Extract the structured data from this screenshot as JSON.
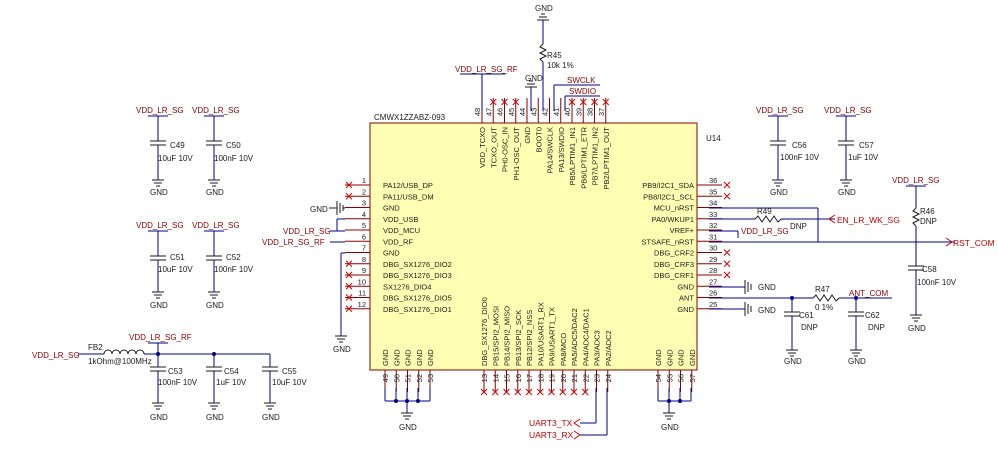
{
  "chip": {
    "ref": "U14",
    "part": "CMWX1ZZABZ-093",
    "fill": "#ffffb3",
    "left_pins": [
      {
        "num": "1",
        "name": "PA12/USB_DP"
      },
      {
        "num": "2",
        "name": "PA11/USB_DM"
      },
      {
        "num": "3",
        "name": "GND"
      },
      {
        "num": "4",
        "name": "VDD_USB"
      },
      {
        "num": "5",
        "name": "VDD_MCU"
      },
      {
        "num": "6",
        "name": "VDD_RF"
      },
      {
        "num": "7",
        "name": "GND"
      },
      {
        "num": "8",
        "name": "DBG_SX1276_DIO2"
      },
      {
        "num": "9",
        "name": "DBG_SX1276_DIO3"
      },
      {
        "num": "10",
        "name": "SX1276_DIO4"
      },
      {
        "num": "11",
        "name": "DBG_SX1276_DIO5"
      },
      {
        "num": "12",
        "name": "DBG_SX1276_DIO1"
      }
    ],
    "right_pins": [
      {
        "num": "36",
        "name": "PB9/I2C1_SDA"
      },
      {
        "num": "35",
        "name": "PB8/I2C1_SCL"
      },
      {
        "num": "34",
        "name": "MCU_nRST"
      },
      {
        "num": "33",
        "name": "PA0/WKUP1"
      },
      {
        "num": "32",
        "name": "VREF+"
      },
      {
        "num": "31",
        "name": "STSAFE_nRST"
      },
      {
        "num": "30",
        "name": "DBG_CRF2"
      },
      {
        "num": "29",
        "name": "DBG_CRF3"
      },
      {
        "num": "28",
        "name": "DBG_CRF1"
      },
      {
        "num": "27",
        "name": "GND"
      },
      {
        "num": "26",
        "name": "ANT"
      },
      {
        "num": "25",
        "name": "GND"
      }
    ],
    "top_pins": [
      {
        "num": "48",
        "name": "VDD_TCXO"
      },
      {
        "num": "47",
        "name": "TCXO_OUT"
      },
      {
        "num": "46",
        "name": "PH0-OSC_IN"
      },
      {
        "num": "45",
        "name": "PH1-OSC_OUT"
      },
      {
        "num": "44",
        "name": "GND"
      },
      {
        "num": "43",
        "name": "BOOT0"
      },
      {
        "num": "42",
        "name": "PA14/SWCLK"
      },
      {
        "num": "41",
        "name": "PA13/SWDIO"
      },
      {
        "num": "40",
        "name": "PB5/LPTIM1_IN1"
      },
      {
        "num": "39",
        "name": "PB6/LPTIM1_ETR"
      },
      {
        "num": "38",
        "name": "PB7/LPTIM1_IN2"
      },
      {
        "num": "37",
        "name": "PB2/LPTIM1_OUT"
      }
    ],
    "bottom_left_pins": [
      {
        "num": "49",
        "name": "GND"
      },
      {
        "num": "50",
        "name": "GND"
      },
      {
        "num": "51",
        "name": "GND"
      },
      {
        "num": "52",
        "name": "GND"
      },
      {
        "num": "53",
        "name": "GND"
      }
    ],
    "bottom_mid_pins": [
      {
        "num": "13",
        "name": "DBG_SX1276_DIO0"
      },
      {
        "num": "14",
        "name": "PB15/SPI2_MOSI"
      },
      {
        "num": "15",
        "name": "PB14/SPI2_MISO"
      },
      {
        "num": "16",
        "name": "PB13/SPI2_SCK"
      },
      {
        "num": "17",
        "name": "PB12/SPI2_NSS"
      },
      {
        "num": "18",
        "name": "PA10/USART1_RX"
      },
      {
        "num": "19",
        "name": "PA9/USART1_TX"
      },
      {
        "num": "20",
        "name": "PA8/MCO"
      },
      {
        "num": "21",
        "name": "PA5/ADC5/DAC2"
      },
      {
        "num": "22",
        "name": "PA4/ADC4/DAC1"
      },
      {
        "num": "23",
        "name": "PA3/ADC3"
      },
      {
        "num": "24",
        "name": "PA2/ADC2"
      }
    ],
    "bottom_right_pins": [
      {
        "num": "54",
        "name": "GND"
      },
      {
        "num": "55",
        "name": "GND"
      },
      {
        "num": "56",
        "name": "GND"
      },
      {
        "num": "57",
        "name": "GND"
      }
    ]
  },
  "nets": {
    "vdd_lr_sg": "VDD_LR_SG",
    "vdd_lr_sg_rf": "VDD_LR_SG_RF",
    "gnd": "GND",
    "swclk": "SWCLK",
    "swdio": "SWDIO",
    "en_lr_wk_sg": "EN_LR_WK_SG",
    "rst_com": "RST_COM",
    "ant_com": "ANT_COM",
    "uart3_tx": "UART3_TX",
    "uart3_rx": "UART3_RX"
  },
  "components": {
    "r45": {
      "ref": "R45",
      "value": "10k 1%"
    },
    "r49": {
      "ref": "R49",
      "value": "DNP"
    },
    "r46": {
      "ref": "R46",
      "value": "DNP"
    },
    "r47": {
      "ref": "R47",
      "value": "0 1%"
    },
    "c49": {
      "ref": "C49",
      "value": "10uF 10V"
    },
    "c50": {
      "ref": "C50",
      "value": "100nF 10V"
    },
    "c51": {
      "ref": "C51",
      "value": "10uF 10V"
    },
    "c52": {
      "ref": "C52",
      "value": "100nF 10V"
    },
    "c53": {
      "ref": "C53",
      "value": "100nF 10V"
    },
    "c54": {
      "ref": "C54",
      "value": "1uF 10V"
    },
    "c55": {
      "ref": "C55",
      "value": "10uF 10V"
    },
    "c56": {
      "ref": "C56",
      "value": "100nF 10V"
    },
    "c57": {
      "ref": "C57",
      "value": "1uF 10V"
    },
    "c58": {
      "ref": "C58",
      "value": "100nF 10V"
    },
    "c61": {
      "ref": "C61",
      "value": "DNP"
    },
    "c62": {
      "ref": "C62",
      "value": "DNP"
    },
    "fb2": {
      "ref": "FB2",
      "value": "1kOhm@100MHz"
    }
  }
}
